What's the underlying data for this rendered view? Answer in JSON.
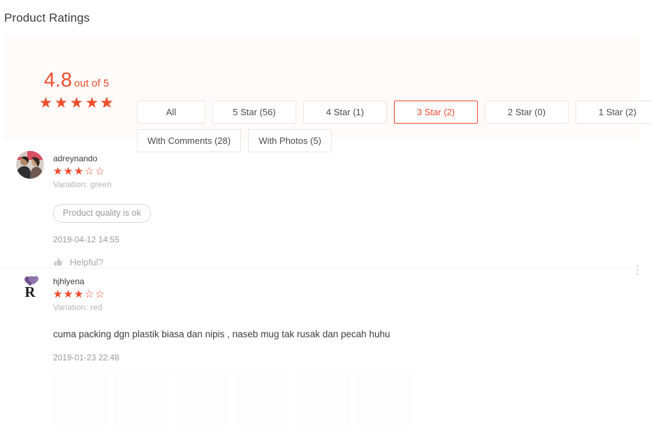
{
  "page_title": "Product Ratings",
  "colors": {
    "accent": "#ee4d2d",
    "panel_bg": "#fffbfa",
    "text": "#3c3c3c",
    "muted": "#9b9b9b"
  },
  "summary": {
    "score": "4.8",
    "score_suffix": "out of 5",
    "stars_filled": 4.8,
    "stars_total": 5
  },
  "filters": {
    "row1": [
      {
        "label": "All",
        "active": false,
        "width": "normal"
      },
      {
        "label": "5 Star (56)",
        "active": false,
        "width": "med"
      },
      {
        "label": "4 Star (1)",
        "active": false,
        "width": "med"
      },
      {
        "label": "3 Star (2)",
        "active": true,
        "width": "med"
      },
      {
        "label": "2 Star (0)",
        "active": false,
        "width": "med"
      },
      {
        "label": "1 Star (2)",
        "active": false,
        "width": "med"
      }
    ],
    "row2": [
      {
        "label": "With Comments (28)",
        "active": false,
        "width": "wide"
      },
      {
        "label": "With Photos (5)",
        "active": false,
        "width": "med"
      }
    ]
  },
  "reviews": [
    {
      "name": "adreynando",
      "rating": 3,
      "rating_total": 5,
      "variation": "Variation: green",
      "tag": "Product quality is ok",
      "text": "",
      "date": "2019-04-12 14:55",
      "helpful_label": "Helpful?",
      "avatar_type": "photo-couple"
    },
    {
      "name": "hjhlyena",
      "rating": 3,
      "rating_total": 5,
      "variation": "Variation: red",
      "tag": "",
      "text": "cuma packing dgn plastik biasa dan nipis , naseb mug tak rusak dan pecah huhu",
      "date": "2019-01-23 22:48",
      "helpful_label": "",
      "avatar_type": "heart-r-logo"
    }
  ]
}
